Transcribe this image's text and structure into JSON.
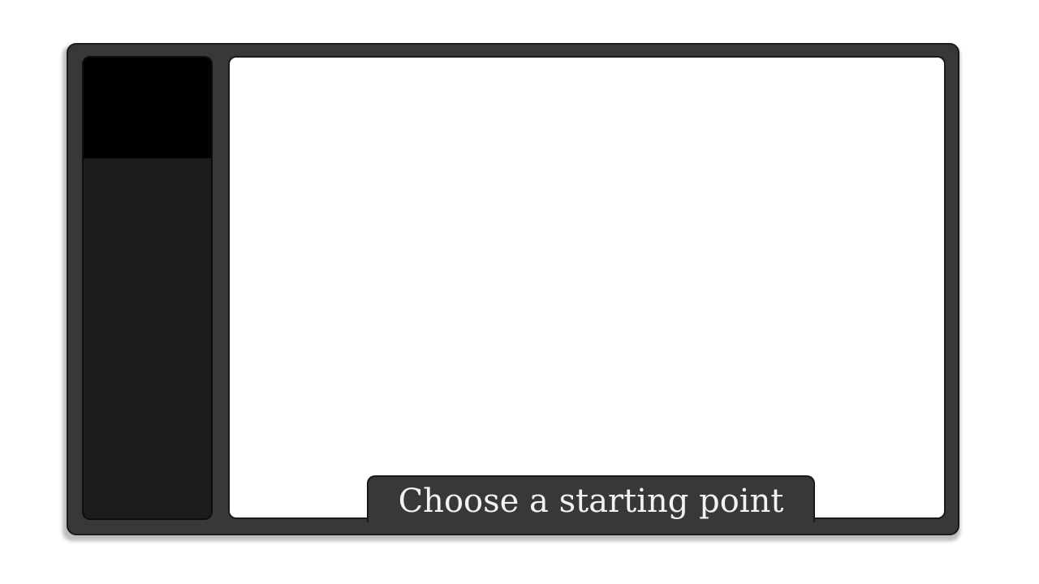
{
  "prompt": {
    "text": "Choose a starting point"
  },
  "colors": {
    "frame": "#383838",
    "side_panel": "#1c1c1c",
    "side_panel_header": "#000000",
    "screen": "#ffffff",
    "prompt_text": "#f2f2f2"
  }
}
